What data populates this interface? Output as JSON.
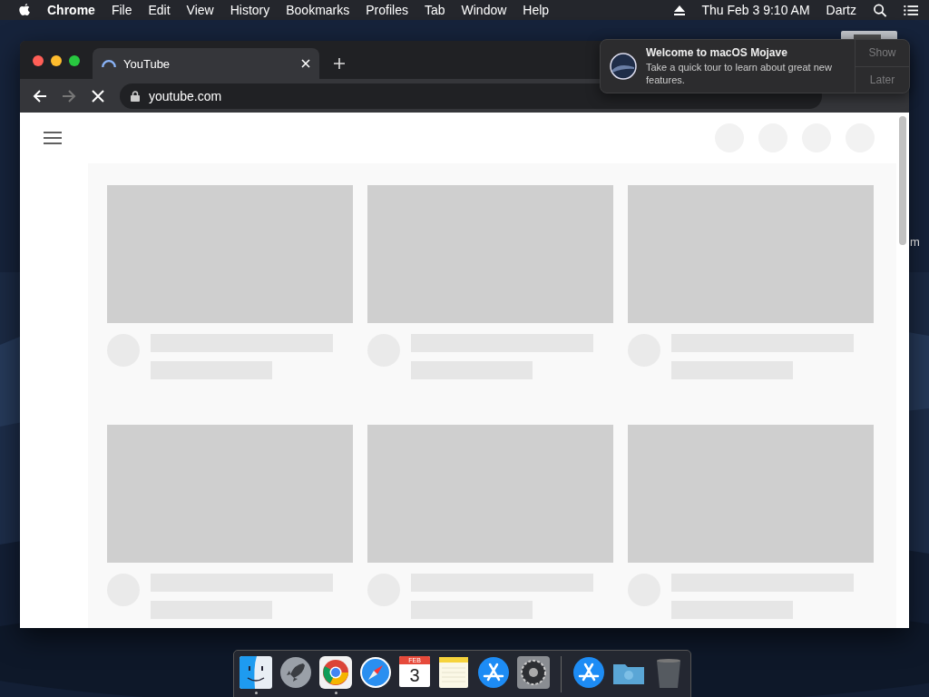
{
  "menu_bar": {
    "app_name": "Chrome",
    "menus": [
      "File",
      "Edit",
      "View",
      "History",
      "Bookmarks",
      "Profiles",
      "Tab",
      "Window",
      "Help"
    ],
    "clock": "Thu Feb 3  9:10 AM",
    "user": "Dartz"
  },
  "desktop_label": "m",
  "browser": {
    "tab": {
      "title": "YouTube",
      "loading": true
    },
    "address": "youtube.com",
    "header_placeholders": [
      {
        "kind": "circle"
      },
      {
        "kind": "circle"
      },
      {
        "kind": "circle"
      },
      {
        "kind": "circle"
      }
    ],
    "video_placeholders": [
      {
        "kind": "card"
      },
      {
        "kind": "card"
      },
      {
        "kind": "card"
      },
      {
        "kind": "card"
      },
      {
        "kind": "card"
      },
      {
        "kind": "card"
      }
    ]
  },
  "notification": {
    "title": "Welcome to macOS Mojave",
    "body": "Take a quick tour to learn about great new features.",
    "buttons": [
      "Show",
      "Later"
    ]
  },
  "dock": {
    "items": [
      {
        "kind": "finder",
        "running": true
      },
      {
        "kind": "launchpad",
        "running": false
      },
      {
        "kind": "chrome",
        "running": true
      },
      {
        "kind": "safari",
        "running": false
      },
      {
        "kind": "calendar",
        "running": false,
        "month": "FEB",
        "day": "3"
      },
      {
        "kind": "notes",
        "running": false
      },
      {
        "kind": "appstore",
        "running": false
      },
      {
        "kind": "settings",
        "running": false
      },
      {
        "kind": "separator"
      },
      {
        "kind": "appstore",
        "running": false
      },
      {
        "kind": "folder",
        "running": false
      },
      {
        "kind": "trash",
        "running": false
      }
    ]
  }
}
